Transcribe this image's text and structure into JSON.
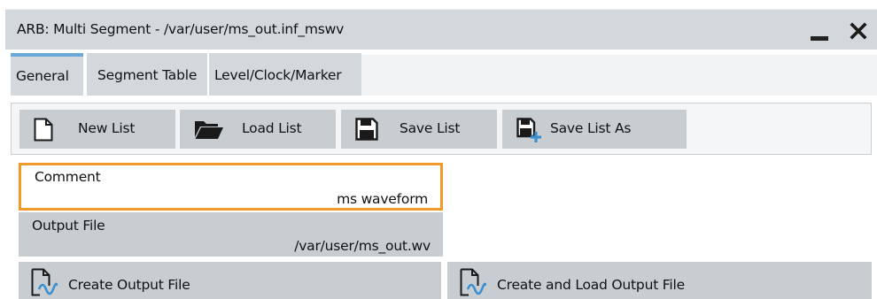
{
  "window": {
    "title": "ARB: Multi Segment - /var/user/ms_out.inf_mswv",
    "minimize_icon": "minimize-icon",
    "close_icon": "close-icon"
  },
  "tabs": [
    {
      "label": "General",
      "active": true
    },
    {
      "label": "Segment Table",
      "active": false
    },
    {
      "label": "Level/Clock/Marker",
      "active": false
    }
  ],
  "toolbar": {
    "new_list": {
      "label": "New List",
      "icon": "new-document-icon"
    },
    "load_list": {
      "label": "Load List",
      "icon": "folder-open-icon"
    },
    "save_list": {
      "label": "Save List",
      "icon": "floppy-disk-icon"
    },
    "save_list_as": {
      "label": "Save List As",
      "icon": "floppy-disk-plus-icon"
    }
  },
  "comment": {
    "label": "Comment",
    "value": "ms waveform"
  },
  "output_file": {
    "label": "Output File",
    "value": "/var/user/ms_out.wv"
  },
  "actions": {
    "create": {
      "label": "Create Output File",
      "icon": "waveform-file-icon"
    },
    "create_load": {
      "label": "Create and Load Output File",
      "icon": "waveform-file-icon"
    }
  },
  "colors": {
    "accent_tab": "#6aa8d8",
    "focus_border": "#f09a2c",
    "waveform_icon": "#3a8fd0",
    "button_bg": "#c8cdd2",
    "titlebar_bg": "#d3d8dd"
  }
}
